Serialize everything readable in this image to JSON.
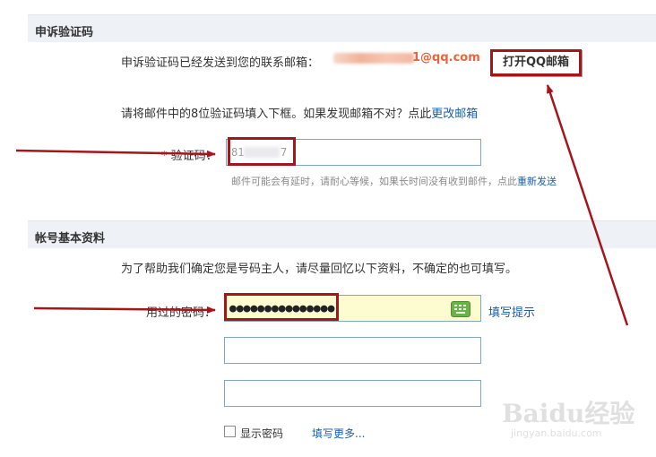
{
  "appeal_section": {
    "title": "申诉验证码",
    "sent_text": "申诉验证码已经发送到您的联系邮箱：",
    "email_domain": "1@qq.com",
    "open_mail_button": "打开QQ邮箱",
    "instruction_text": "请将邮件中的8位验证码填入下框。如果发现邮箱不对？点此",
    "change_email_link": "更改邮箱",
    "code_label_star": "*",
    "code_label": "验证码：",
    "code_value_start": "81",
    "code_value_end": "7",
    "delay_note": "邮件可能会有延时，请耐心等候，如果长时间没有收到邮件，点此",
    "resend_link": "重新发送"
  },
  "account_section": {
    "title": "帐号基本资料",
    "intro_text": "为了帮助我们确定您是号码主人，请尽量回忆以下资料，不确定的也可填写。",
    "used_password_label": "用过的密码：",
    "password_mask": "●●●●●●●●●●●●●●●",
    "fill_hint_link": "填写提示",
    "show_password_label": "显示密码",
    "fill_more_link": "填写更多..."
  },
  "watermark": {
    "main": "Baidu经验",
    "sub": "jingyan.baidu.com"
  },
  "colors": {
    "highlight": "#a3161b",
    "link": "#1a5fa8",
    "email_domain": "#e8643c",
    "section_bar": "#eef2f7"
  }
}
